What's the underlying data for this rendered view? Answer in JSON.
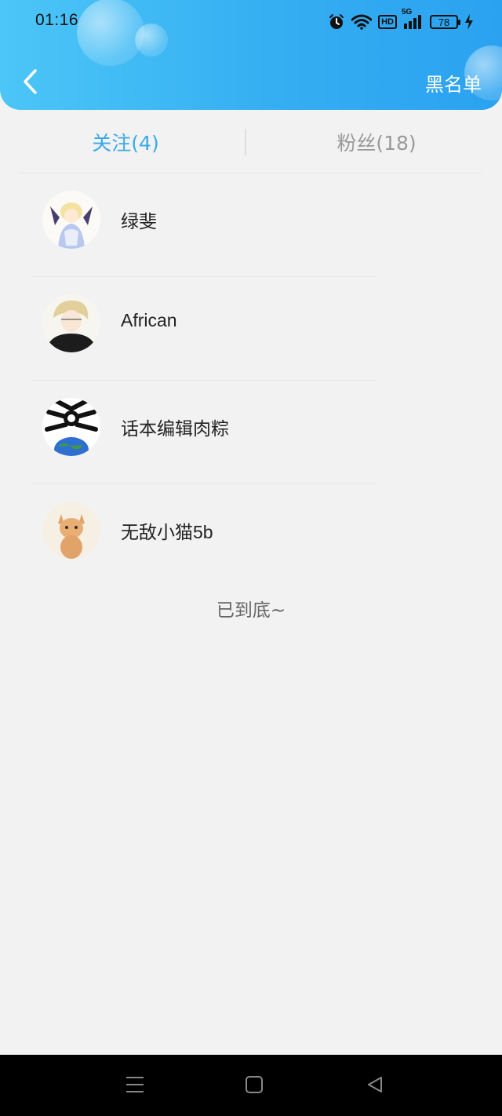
{
  "status_bar": {
    "time": "01:16",
    "network": "5G",
    "hd_label": "HD",
    "battery": "78",
    "icons": [
      "alarm-icon",
      "wifi-icon",
      "hd-icon",
      "signal-5g-icon",
      "battery-icon",
      "charging-icon"
    ]
  },
  "header": {
    "back_icon": "chevron-left-icon",
    "blacklist_label": "黑名单"
  },
  "tabs": [
    {
      "label": "关注(4)",
      "active": true
    },
    {
      "label": "粉丝(18)",
      "active": false
    }
  ],
  "following": [
    {
      "name": "绿斐",
      "avatar": "anime-avatar-winged"
    },
    {
      "name": "African",
      "avatar": "anime-avatar-blond"
    },
    {
      "name": "话本编辑肉粽",
      "avatar": "earth-bones-avatar"
    },
    {
      "name": "无敌小猫5b",
      "avatar": "kitten-avatar"
    }
  ],
  "end_text": "已到底~",
  "nav_bar": {
    "buttons": [
      "menu-icon",
      "home-icon",
      "back-triangle-icon"
    ]
  },
  "colors": {
    "header_gradient_start": "#4cc6f7",
    "header_gradient_end": "#2aa2f0",
    "active_tab": "#3aa9e8",
    "inactive_tab": "#999999",
    "background": "#f2f2f2"
  }
}
